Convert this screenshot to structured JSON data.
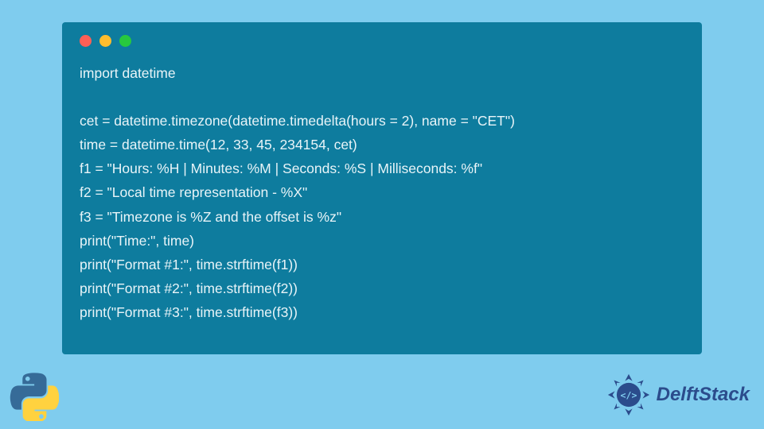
{
  "code": {
    "lines": [
      "import datetime",
      "",
      "cet = datetime.timezone(datetime.timedelta(hours = 2), name = \"CET\")",
      "time = datetime.time(12, 33, 45, 234154, cet)",
      "f1 = \"Hours: %H | Minutes: %M | Seconds: %S | Milliseconds: %f\"",
      "f2 = \"Local time representation - %X\"",
      "f3 = \"Timezone is %Z and the offset is %z\"",
      "print(\"Time:\", time)",
      "print(\"Format #1:\", time.strftime(f1))",
      "print(\"Format #2:\", time.strftime(f2))",
      "print(\"Format #3:\", time.strftime(f3))"
    ]
  },
  "brand": {
    "name": "DelftStack"
  },
  "colors": {
    "background": "#7FCCEE",
    "codeWindow": "#0E7C9E",
    "codeText": "#E8F4F8",
    "dotRed": "#FF5F56",
    "dotYellow": "#FFBD2E",
    "dotGreen": "#27C93F",
    "brandText": "#2B4C8C"
  }
}
